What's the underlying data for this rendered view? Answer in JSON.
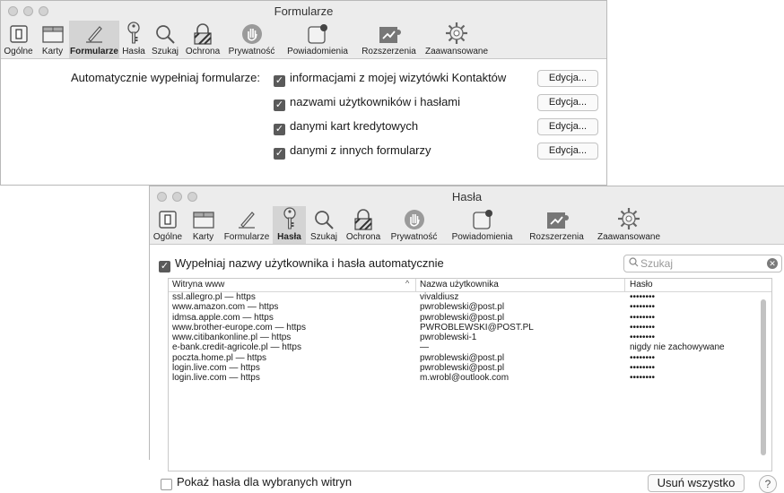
{
  "formularze_window": {
    "title": "Formularze",
    "toolbar": [
      {
        "label": "Ogólne",
        "icon": "general-switch-icon"
      },
      {
        "label": "Karty",
        "icon": "tabs-icon"
      },
      {
        "label": "Formularze",
        "icon": "pencil-form-icon",
        "selected": true
      },
      {
        "label": "Hasła",
        "icon": "key-icon"
      },
      {
        "label": "Szukaj",
        "icon": "search-icon"
      },
      {
        "label": "Ochrona",
        "icon": "lock-icon"
      },
      {
        "label": "Prywatność",
        "icon": "hand-icon"
      },
      {
        "label": "Powiadomienia",
        "icon": "notification-icon"
      },
      {
        "label": "Rozszerzenia",
        "icon": "puzzle-icon"
      },
      {
        "label": "Zaawansowane",
        "icon": "gear-icon"
      }
    ],
    "autofill_label": "Automatycznie wypełniaj formularze:",
    "options": [
      {
        "label": "informacjami z mojej wizytówki Kontaktów",
        "checked": true,
        "button": "Edycja..."
      },
      {
        "label": "nazwami użytkowników i hasłami",
        "checked": true,
        "button": "Edycja..."
      },
      {
        "label": "danymi kart kredytowych",
        "checked": true,
        "button": "Edycja..."
      },
      {
        "label": "danymi z innych formularzy",
        "checked": true,
        "button": "Edycja..."
      }
    ]
  },
  "hasla_window": {
    "title": "Hasła",
    "toolbar": [
      {
        "label": "Ogólne",
        "icon": "general-switch-icon"
      },
      {
        "label": "Karty",
        "icon": "tabs-icon"
      },
      {
        "label": "Formularze",
        "icon": "pencil-form-icon"
      },
      {
        "label": "Hasła",
        "icon": "key-icon",
        "selected": true
      },
      {
        "label": "Szukaj",
        "icon": "search-icon"
      },
      {
        "label": "Ochrona",
        "icon": "lock-icon"
      },
      {
        "label": "Prywatność",
        "icon": "hand-icon"
      },
      {
        "label": "Powiadomienia",
        "icon": "notification-icon"
      },
      {
        "label": "Rozszerzenia",
        "icon": "puzzle-icon"
      },
      {
        "label": "Zaawansowane",
        "icon": "gear-icon"
      }
    ],
    "autofill_checkbox": "Wypełniaj nazwy użytkownika i hasła automatycznie",
    "search_placeholder": "Szukaj",
    "columns": [
      "Witryna www",
      "Nazwa użytkownika",
      "Hasło"
    ],
    "rows": [
      {
        "site": "ssl.allegro.pl — https",
        "user": "vivaldiusz",
        "pass": "••••••••"
      },
      {
        "site": "www.amazon.com — https",
        "user": "pwroblewski@post.pl",
        "pass": "••••••••"
      },
      {
        "site": "idmsa.apple.com — https",
        "user": "pwroblewski@post.pl",
        "pass": "••••••••"
      },
      {
        "site": "www.brother-europe.com — https",
        "user": "PWROBLEWSKI@POST.PL",
        "pass": "••••••••"
      },
      {
        "site": "www.citibankonline.pl — https",
        "user": "pwroblewski-1",
        "pass": "••••••••"
      },
      {
        "site": "e-bank.credit-agricole.pl — https",
        "user": "—",
        "pass": "nigdy nie zachowywane"
      },
      {
        "site": "poczta.home.pl — https",
        "user": "pwroblewski@post.pl",
        "pass": "••••••••"
      },
      {
        "site": "login.live.com — https",
        "user": "pwroblewski@post.pl",
        "pass": "••••••••"
      },
      {
        "site": "login.live.com — https",
        "user": "m.wrobl@outlook.com",
        "pass": "••••••••"
      }
    ],
    "show_passwords_checkbox": "Pokaż hasła dla wybranych witryn",
    "delete_all_button": "Usuń wszystko",
    "help_button": "?"
  }
}
